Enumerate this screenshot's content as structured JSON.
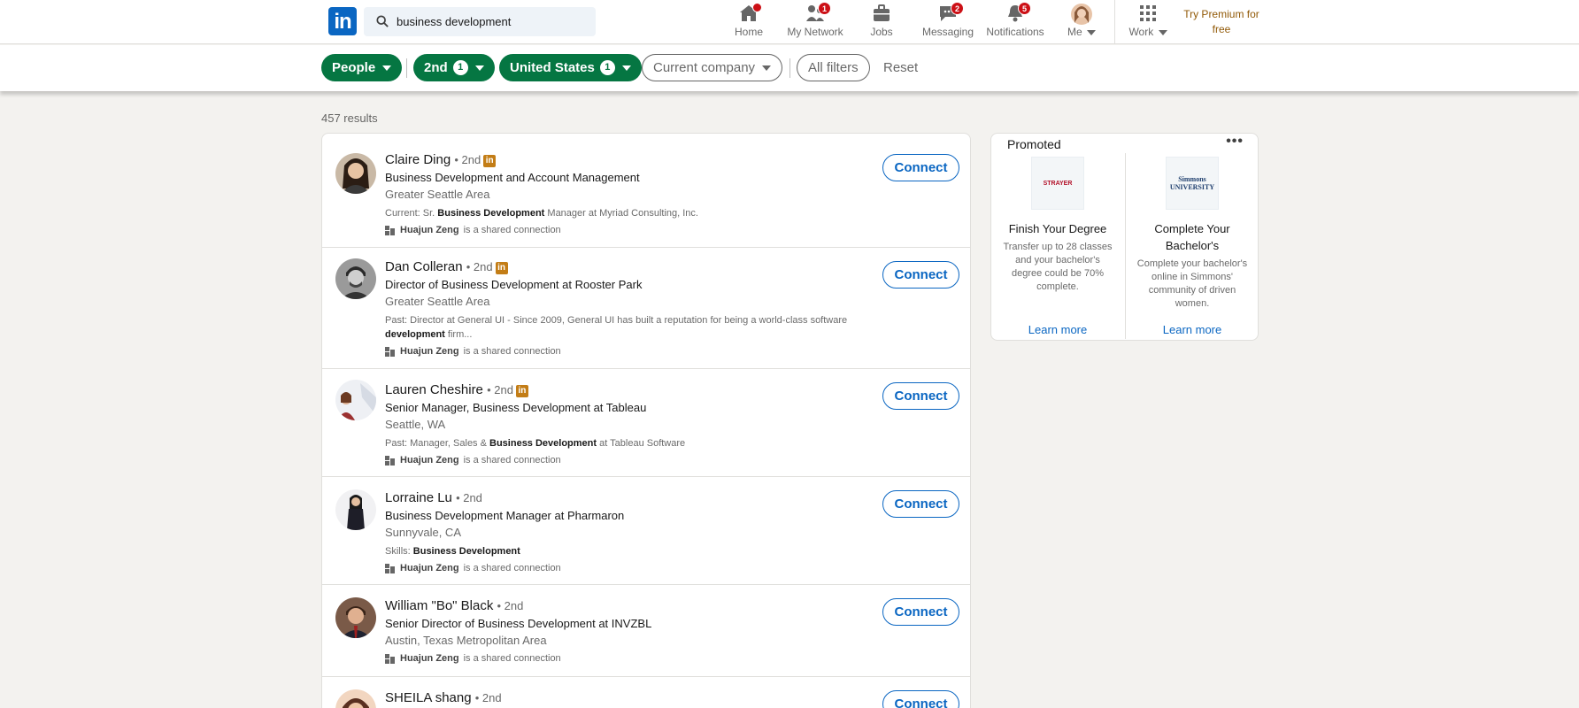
{
  "nav": {
    "logo": "in",
    "search_value": "business development",
    "items": [
      {
        "label": "Home",
        "icon": "home-icon",
        "badge": ""
      },
      {
        "label": "My Network",
        "icon": "network-icon",
        "badge": "1"
      },
      {
        "label": "Jobs",
        "icon": "briefcase-icon",
        "badge": ""
      },
      {
        "label": "Messaging",
        "icon": "messaging-icon",
        "badge": "2"
      },
      {
        "label": "Notifications",
        "icon": "bell-icon",
        "badge": "5"
      },
      {
        "label": "Me",
        "icon": "avatar",
        "badge": ""
      },
      {
        "label": "Work",
        "icon": "grid-icon",
        "badge": ""
      }
    ],
    "premium": "Try Premium for free"
  },
  "filters": {
    "people": "People",
    "degree": "2nd",
    "degree_count": "1",
    "location": "United States",
    "location_count": "1",
    "company": "Current company",
    "all_filters": "All filters",
    "reset": "Reset"
  },
  "results_count": "457 results",
  "results": [
    {
      "name": "Claire Ding",
      "degree": "• 2nd",
      "headline": "Business Development and Account Management",
      "location": "Greater Seattle Area",
      "snippet_pre": "Current: Sr. ",
      "snippet_bold": "Business Development",
      "snippet_post": " Manager at Myriad Consulting, Inc.",
      "shared_name": "Huajun Zeng",
      "shared_text": "is a shared connection",
      "connect": "Connect"
    },
    {
      "name": "Dan Colleran",
      "degree": "• 2nd",
      "headline": "Director of Business Development at Rooster Park",
      "location": "Greater Seattle Area",
      "snippet_pre": "Past: Director at General UI - Since 2009, General UI has built a reputation for being a world-class software ",
      "snippet_bold": "development",
      "snippet_post": " firm...",
      "shared_name": "Huajun Zeng",
      "shared_text": "is a shared connection",
      "connect": "Connect"
    },
    {
      "name": "Lauren Cheshire",
      "degree": "• 2nd",
      "headline": "Senior Manager, Business Development at Tableau",
      "location": "Seattle, WA",
      "snippet_pre": "Past: Manager, Sales & ",
      "snippet_bold": "Business Development",
      "snippet_post": " at Tableau Software",
      "shared_name": "Huajun Zeng",
      "shared_text": "is a shared connection",
      "connect": "Connect"
    },
    {
      "name": "Lorraine Lu",
      "degree": "• 2nd",
      "headline": "Business Development Manager at Pharmaron",
      "location": "Sunnyvale, CA",
      "snippet_pre": "Skills: ",
      "snippet_bold": "Business Development",
      "snippet_post": "",
      "shared_name": "Huajun Zeng",
      "shared_text": "is a shared connection",
      "connect": "Connect"
    },
    {
      "name": "William \"Bo\" Black",
      "degree": "• 2nd",
      "headline": "Senior Director of Business Development at INVZBL",
      "location": "Austin, Texas Metropolitan Area",
      "shared_name": "Huajun Zeng",
      "shared_text": "is a shared connection",
      "connect": "Connect"
    },
    {
      "name": "SHEILA shang",
      "degree": "• 2nd",
      "connect": "Connect"
    }
  ],
  "promoted": {
    "title": "Promoted",
    "more": "•••",
    "ads": [
      {
        "logo": "STRAYER",
        "title": "Finish Your Degree",
        "body": "Transfer up to 28 classes and your bachelor's degree could be 70% complete.",
        "cta": "Learn more"
      },
      {
        "logo": "Simmons UNIVERSITY",
        "title": "Complete Your Bachelor's",
        "body": "Complete your bachelor's online in Simmons' community of driven women.",
        "cta": "Learn more"
      }
    ]
  },
  "colors": {
    "brand": "#0a66c2",
    "filter_green": "#057642",
    "premium": "#915907",
    "badge": "#cc1016"
  }
}
